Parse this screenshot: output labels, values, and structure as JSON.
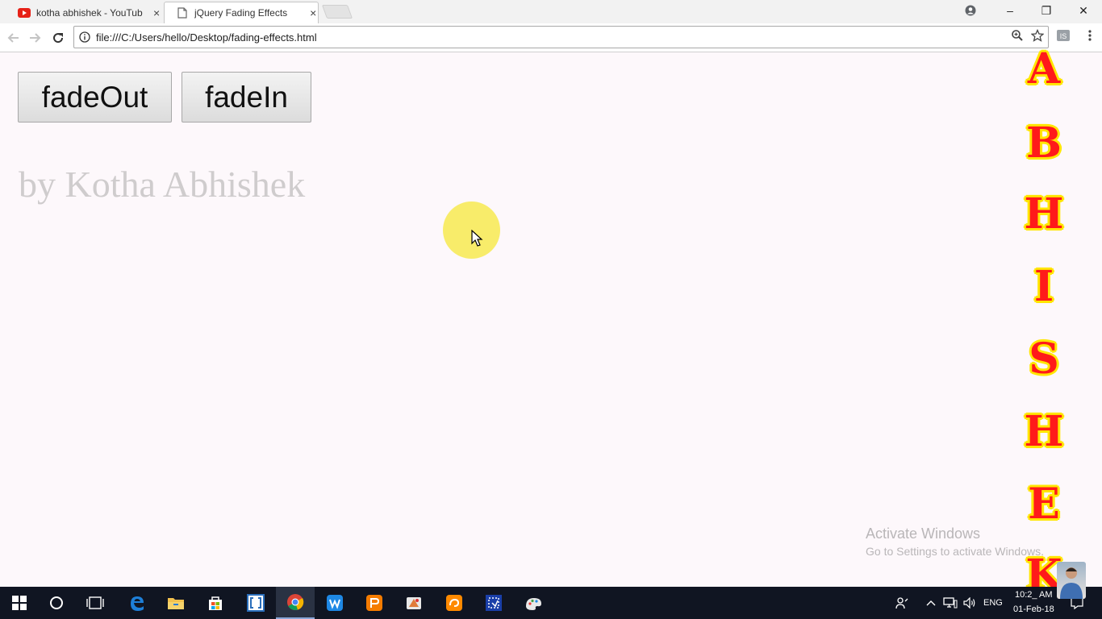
{
  "browser": {
    "tabs": [
      {
        "title": "kotha abhishek - YouTub",
        "favicon": "youtube-icon",
        "active": false
      },
      {
        "title": "jQuery Fading Effects",
        "favicon": "page-icon",
        "active": true
      }
    ],
    "close_glyph": "×",
    "url": "file:///C:/Users/hello/Desktop/fading-effects.html",
    "window_controls": {
      "minimize": "–",
      "maximize": "❐",
      "close": "✕"
    }
  },
  "page": {
    "buttons": {
      "fade_out": "fadeOut",
      "fade_in": "fadeIn"
    },
    "byline": "by Kotha Abhishek",
    "activation": {
      "title": "Activate Windows",
      "subtitle": "Go to Settings to activate Windows."
    },
    "side_letters": [
      "A",
      "B",
      "H",
      "I",
      "S",
      "H",
      "E",
      "K"
    ]
  },
  "taskbar": {
    "apps": [
      "start-icon",
      "cortana-icon",
      "task-view-icon",
      "edge-icon",
      "file-explorer-icon",
      "store-icon",
      "brackets-icon",
      "chrome-icon",
      "wps-writer-icon",
      "wps-presentation-icon",
      "app-icon",
      "uc-browser-icon",
      "snipping-icon",
      "paint-icon"
    ],
    "tray": {
      "language": "ENG",
      "time": "10:2_ AM",
      "date": "01-Feb-18"
    }
  },
  "colors": {
    "letter_fill": "#ff1a1a",
    "letter_outline": "#ffe600",
    "cursor_halo": "#f8ec6a",
    "taskbar": "#101522"
  }
}
